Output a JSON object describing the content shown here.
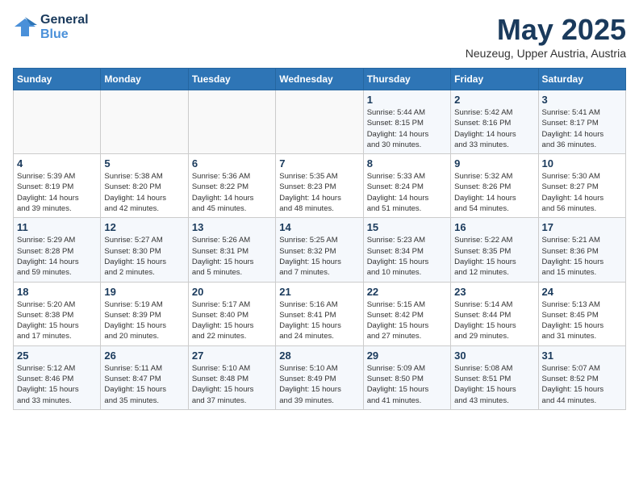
{
  "logo": {
    "line1": "General",
    "line2": "Blue"
  },
  "title": "May 2025",
  "location": "Neuzeug, Upper Austria, Austria",
  "weekdays": [
    "Sunday",
    "Monday",
    "Tuesday",
    "Wednesday",
    "Thursday",
    "Friday",
    "Saturday"
  ],
  "weeks": [
    [
      {
        "day": "",
        "info": ""
      },
      {
        "day": "",
        "info": ""
      },
      {
        "day": "",
        "info": ""
      },
      {
        "day": "",
        "info": ""
      },
      {
        "day": "1",
        "info": "Sunrise: 5:44 AM\nSunset: 8:15 PM\nDaylight: 14 hours\nand 30 minutes."
      },
      {
        "day": "2",
        "info": "Sunrise: 5:42 AM\nSunset: 8:16 PM\nDaylight: 14 hours\nand 33 minutes."
      },
      {
        "day": "3",
        "info": "Sunrise: 5:41 AM\nSunset: 8:17 PM\nDaylight: 14 hours\nand 36 minutes."
      }
    ],
    [
      {
        "day": "4",
        "info": "Sunrise: 5:39 AM\nSunset: 8:19 PM\nDaylight: 14 hours\nand 39 minutes."
      },
      {
        "day": "5",
        "info": "Sunrise: 5:38 AM\nSunset: 8:20 PM\nDaylight: 14 hours\nand 42 minutes."
      },
      {
        "day": "6",
        "info": "Sunrise: 5:36 AM\nSunset: 8:22 PM\nDaylight: 14 hours\nand 45 minutes."
      },
      {
        "day": "7",
        "info": "Sunrise: 5:35 AM\nSunset: 8:23 PM\nDaylight: 14 hours\nand 48 minutes."
      },
      {
        "day": "8",
        "info": "Sunrise: 5:33 AM\nSunset: 8:24 PM\nDaylight: 14 hours\nand 51 minutes."
      },
      {
        "day": "9",
        "info": "Sunrise: 5:32 AM\nSunset: 8:26 PM\nDaylight: 14 hours\nand 54 minutes."
      },
      {
        "day": "10",
        "info": "Sunrise: 5:30 AM\nSunset: 8:27 PM\nDaylight: 14 hours\nand 56 minutes."
      }
    ],
    [
      {
        "day": "11",
        "info": "Sunrise: 5:29 AM\nSunset: 8:28 PM\nDaylight: 14 hours\nand 59 minutes."
      },
      {
        "day": "12",
        "info": "Sunrise: 5:27 AM\nSunset: 8:30 PM\nDaylight: 15 hours\nand 2 minutes."
      },
      {
        "day": "13",
        "info": "Sunrise: 5:26 AM\nSunset: 8:31 PM\nDaylight: 15 hours\nand 5 minutes."
      },
      {
        "day": "14",
        "info": "Sunrise: 5:25 AM\nSunset: 8:32 PM\nDaylight: 15 hours\nand 7 minutes."
      },
      {
        "day": "15",
        "info": "Sunrise: 5:23 AM\nSunset: 8:34 PM\nDaylight: 15 hours\nand 10 minutes."
      },
      {
        "day": "16",
        "info": "Sunrise: 5:22 AM\nSunset: 8:35 PM\nDaylight: 15 hours\nand 12 minutes."
      },
      {
        "day": "17",
        "info": "Sunrise: 5:21 AM\nSunset: 8:36 PM\nDaylight: 15 hours\nand 15 minutes."
      }
    ],
    [
      {
        "day": "18",
        "info": "Sunrise: 5:20 AM\nSunset: 8:38 PM\nDaylight: 15 hours\nand 17 minutes."
      },
      {
        "day": "19",
        "info": "Sunrise: 5:19 AM\nSunset: 8:39 PM\nDaylight: 15 hours\nand 20 minutes."
      },
      {
        "day": "20",
        "info": "Sunrise: 5:17 AM\nSunset: 8:40 PM\nDaylight: 15 hours\nand 22 minutes."
      },
      {
        "day": "21",
        "info": "Sunrise: 5:16 AM\nSunset: 8:41 PM\nDaylight: 15 hours\nand 24 minutes."
      },
      {
        "day": "22",
        "info": "Sunrise: 5:15 AM\nSunset: 8:42 PM\nDaylight: 15 hours\nand 27 minutes."
      },
      {
        "day": "23",
        "info": "Sunrise: 5:14 AM\nSunset: 8:44 PM\nDaylight: 15 hours\nand 29 minutes."
      },
      {
        "day": "24",
        "info": "Sunrise: 5:13 AM\nSunset: 8:45 PM\nDaylight: 15 hours\nand 31 minutes."
      }
    ],
    [
      {
        "day": "25",
        "info": "Sunrise: 5:12 AM\nSunset: 8:46 PM\nDaylight: 15 hours\nand 33 minutes."
      },
      {
        "day": "26",
        "info": "Sunrise: 5:11 AM\nSunset: 8:47 PM\nDaylight: 15 hours\nand 35 minutes."
      },
      {
        "day": "27",
        "info": "Sunrise: 5:10 AM\nSunset: 8:48 PM\nDaylight: 15 hours\nand 37 minutes."
      },
      {
        "day": "28",
        "info": "Sunrise: 5:10 AM\nSunset: 8:49 PM\nDaylight: 15 hours\nand 39 minutes."
      },
      {
        "day": "29",
        "info": "Sunrise: 5:09 AM\nSunset: 8:50 PM\nDaylight: 15 hours\nand 41 minutes."
      },
      {
        "day": "30",
        "info": "Sunrise: 5:08 AM\nSunset: 8:51 PM\nDaylight: 15 hours\nand 43 minutes."
      },
      {
        "day": "31",
        "info": "Sunrise: 5:07 AM\nSunset: 8:52 PM\nDaylight: 15 hours\nand 44 minutes."
      }
    ]
  ]
}
